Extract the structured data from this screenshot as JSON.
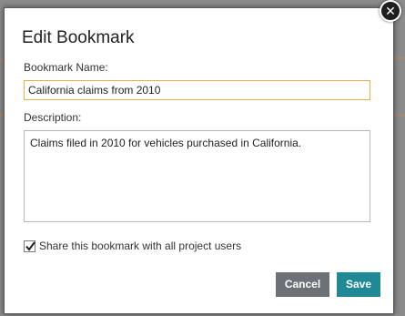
{
  "dialog": {
    "title": "Edit Bookmark",
    "close_icon": "close-icon",
    "name_label": "Bookmark Name:",
    "name_value": "California claims from 2010",
    "description_label": "Description:",
    "description_value": "Claims filed in 2010 for vehicles purchased in California.",
    "share_label": "Share this bookmark with all project users",
    "share_checked": true,
    "cancel_label": "Cancel",
    "save_label": "Save"
  },
  "colors": {
    "save_button": "#1f8a95",
    "cancel_button": "#6b7177",
    "focused_input_border": "#e8b04a"
  }
}
